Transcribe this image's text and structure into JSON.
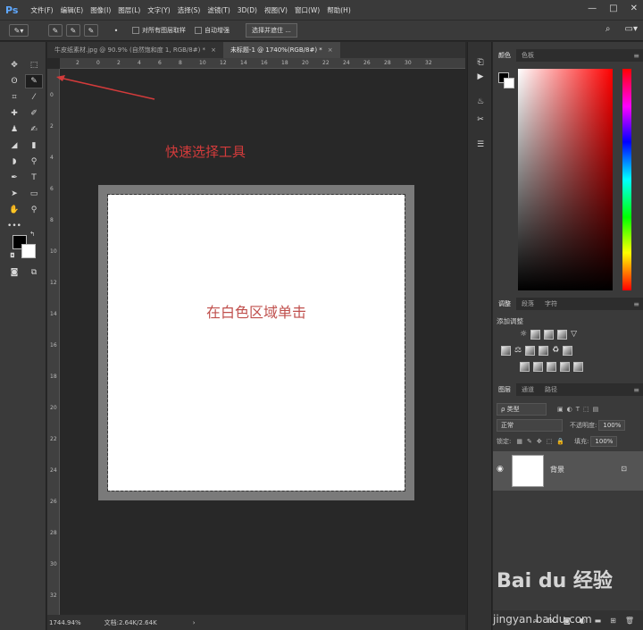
{
  "app": {
    "logo": "Ps"
  },
  "menu": [
    "文件(F)",
    "编辑(E)",
    "图像(I)",
    "图层(L)",
    "文字(Y)",
    "选择(S)",
    "滤镜(T)",
    "3D(D)",
    "视图(V)",
    "窗口(W)",
    "帮助(H)"
  ],
  "window_controls": [
    "—",
    "□",
    "✕"
  ],
  "options": {
    "sample_all_layers": "对所有图层取样",
    "auto_enhance": "自动增强",
    "select_and_mask": "选择并遮住 ..."
  },
  "tabs": [
    {
      "label": "牛皮纸素材.jpg @ 90.9% (自然饱和度 1, RGB/8#) *",
      "active": false
    },
    {
      "label": "未标题-1 @ 1740%(RGB/8#) *",
      "active": true
    }
  ],
  "ruler": {
    "h_ticks": [
      "2",
      "0",
      "2",
      "4",
      "6",
      "8",
      "10",
      "12",
      "14",
      "16",
      "18",
      "20",
      "22",
      "24",
      "26",
      "28",
      "30",
      "32"
    ],
    "v_ticks": [
      "0",
      "2",
      "4",
      "6",
      "8",
      "10",
      "12",
      "14",
      "16",
      "18",
      "20",
      "22",
      "24",
      "26",
      "28",
      "30",
      "32"
    ]
  },
  "annotation": "快速选择工具",
  "canvas_text": "在白色区域单击",
  "status": {
    "zoom": "1744.94%",
    "doc": "文档:2.64K/2.64K",
    "arrow": "›"
  },
  "color_panel": {
    "tabs": [
      "颜色",
      "色板"
    ]
  },
  "adjust_panel": {
    "tabs": [
      "调整",
      "段落",
      "字符"
    ],
    "title": "添加调整"
  },
  "layers_panel": {
    "tabs": [
      "图层",
      "通道",
      "路径"
    ],
    "kind": "ρ 类型",
    "blend": "正常",
    "opacity_label": "不透明度:",
    "opacity": "100%",
    "lock_label": "锁定:",
    "fill_label": "填充:",
    "fill": "100%",
    "layer_name": "背景"
  },
  "watermark": {
    "brand": "Bai du 经验",
    "url": "jingyan.baidu.com"
  }
}
